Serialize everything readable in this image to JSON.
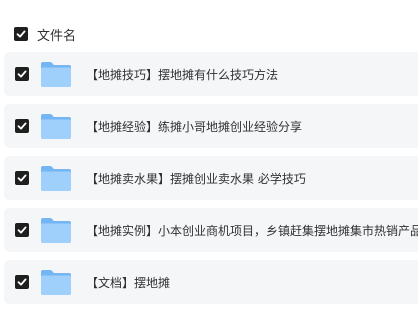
{
  "header": {
    "label": "文件名",
    "checked": true
  },
  "files": [
    {
      "name": "【地摊技巧】摆地摊有什么技巧方法",
      "type": "folder",
      "checked": true
    },
    {
      "name": "【地摊经验】练摊小哥地摊创业经验分享",
      "type": "folder",
      "checked": true
    },
    {
      "name": "【地摊卖水果】摆摊创业卖水果 必学技巧",
      "type": "folder",
      "checked": true
    },
    {
      "name": "【地摊实例】小本创业商机项目，乡镇赶集摆地摊集市热销产品，",
      "type": "folder",
      "checked": true
    },
    {
      "name": "【文档】摆地摊",
      "type": "folder",
      "checked": true
    }
  ],
  "icons": {
    "checkbox": "checkbox-checked-icon",
    "folder": "folder-icon"
  },
  "colors": {
    "checkbox_bg": "#1f1f1f",
    "row_bg": "#f5f6f8",
    "folder_front": "#9fd0fb",
    "folder_back": "#74b5f3"
  }
}
